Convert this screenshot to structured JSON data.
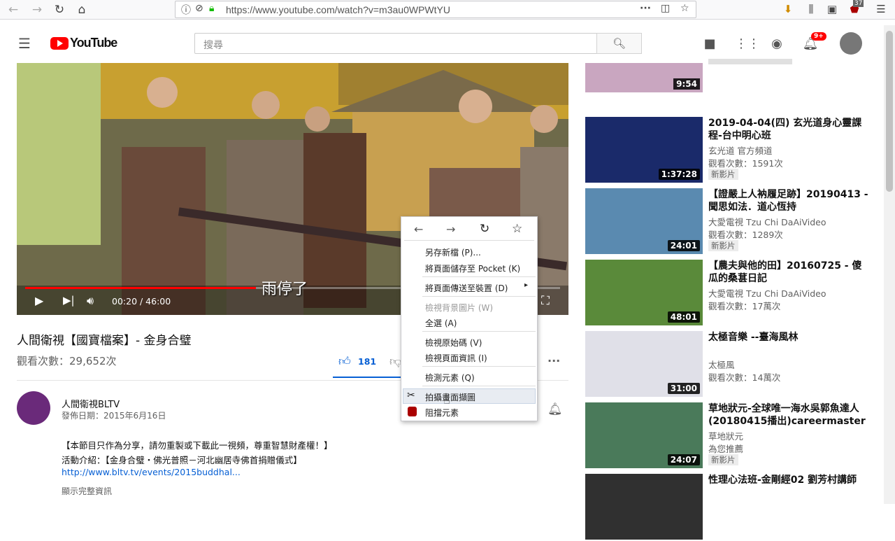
{
  "browser": {
    "url": "https://www.youtube.com/watch?v=m3au0WPWtYU",
    "badge_count": "37"
  },
  "header": {
    "logo_text": "YouTube",
    "search_placeholder": "搜尋",
    "notif_count": "9+"
  },
  "player": {
    "subtitle": "雨停了",
    "time": "00:20 / 46:00",
    "progress_fraction": 0.0072
  },
  "video": {
    "title": "人間衛視【國寶檔案】- 金身合璧",
    "views": "觀看次數：29,652次",
    "likes": "181"
  },
  "channel": {
    "name": "人間衛視BLTV",
    "date": "發佈日期：2015年6月16日",
    "desc1": "【本節目只作為分享，請勿重製或下載此一視頻，尊重智慧財產權！】",
    "desc2": "活動介紹：【金身合璧・佛光普照－河北幽居寺佛首捐贈儀式】",
    "link": "http://www.bltv.tv/events/2015buddhal...",
    "show_more": "顯示完整資訊"
  },
  "context_menu": {
    "items": [
      {
        "label": "另存新檔 (P)..."
      },
      {
        "label": "將頁面儲存至 Pocket (K)"
      },
      {
        "label": "將頁面傳送至裝置 (D)"
      },
      {
        "label": "檢視背景圖片 (W)"
      },
      {
        "label": "全選 (A)"
      },
      {
        "label": "檢視原始碼 (V)"
      },
      {
        "label": "檢視頁面資訊 (I)"
      },
      {
        "label": "檢測元素 (Q)"
      },
      {
        "label": "拍攝畫面擷圖"
      },
      {
        "label": "阻擋元素"
      }
    ]
  },
  "sidebar": {
    "partial_top_duration": "9:54",
    "videos": [
      {
        "title": "2019-04-04(四) 玄光道身心靈課程-台中明心班",
        "channel": "玄光道 官方頻道",
        "views": "觀看次數：1591次",
        "badge": "新影片",
        "duration": "1:37:28"
      },
      {
        "title": "【證嚴上人衲履足跡】20190413 - 聞思如法．道心恆持",
        "channel": "大愛電視 Tzu Chi DaAiVideo",
        "views": "觀看次數：1289次",
        "badge": "新影片",
        "duration": "24:01"
      },
      {
        "title": "【農夫與他的田】20160725 - 傻瓜的桑葚日記",
        "channel": "大愛電視 Tzu Chi DaAiVideo",
        "views": "觀看次數：17萬次",
        "badge": "",
        "duration": "48:01"
      },
      {
        "title": "太極音樂 --臺海風林",
        "channel": "太極風",
        "views": "觀看次數：14萬次",
        "badge": "",
        "duration": "31:00"
      },
      {
        "title": "草地狀元-全球唯一海水吳郭魚達人(20180415播出)careermaster",
        "channel": "草地狀元",
        "views": "為您推薦",
        "badge": "新影片",
        "duration": "24:07"
      },
      {
        "title": "性理心法班-金剛經02 劉芳村講師",
        "channel": "",
        "views": "",
        "badge": "",
        "duration": ""
      }
    ]
  }
}
